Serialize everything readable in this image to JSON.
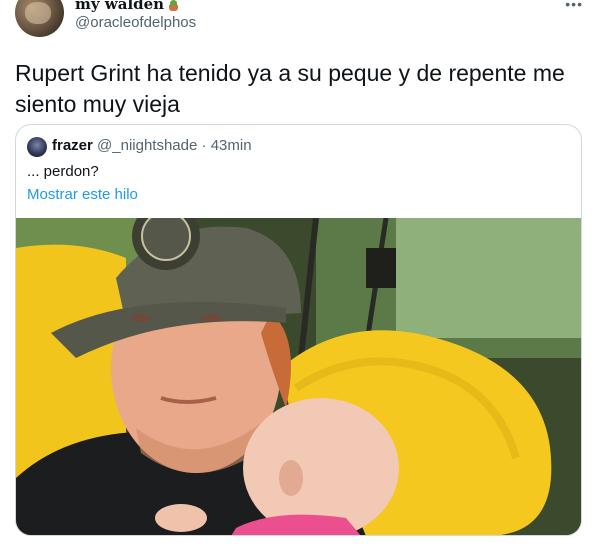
{
  "tweet": {
    "display_name": "my walden",
    "name_emoji": "potted-plant-icon",
    "handle": "@oracleofdelphos",
    "more_icon": "more-dots-icon",
    "text": "Rupert Grint ha tenido ya a su peque y de repente me siento muy vieja"
  },
  "quoted_tweet": {
    "display_name": "frazer",
    "handle": "@_niightshade",
    "separator": "·",
    "time": "43min",
    "text": "... perdon?",
    "show_thread_link": "Mostrar este hilo",
    "photo": "photo-man-in-cap-holding-baby"
  },
  "colors": {
    "text_primary": "#0f1419",
    "text_secondary": "#536471",
    "link": "#1d9bf0",
    "border": "#cfd9de",
    "chair_yellow": "#f2c51c"
  }
}
